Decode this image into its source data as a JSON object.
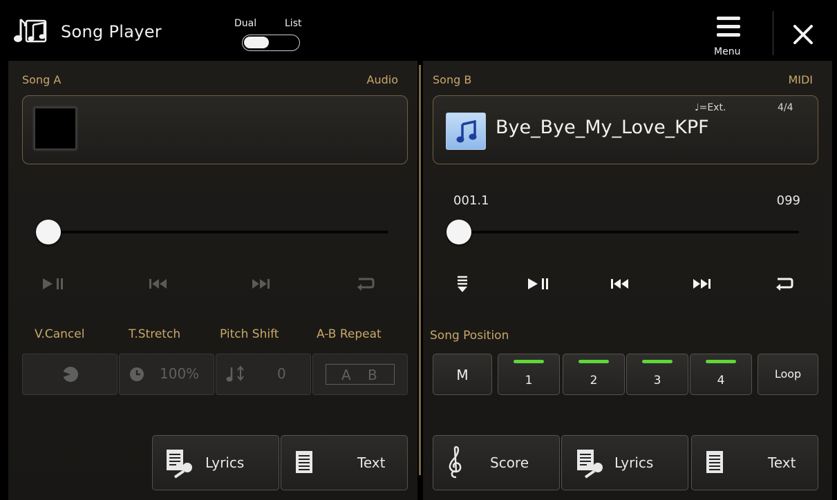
{
  "header": {
    "title": "Song Player",
    "mode_left_label": "Dual",
    "mode_right_label": "List",
    "menu_label": "Menu",
    "icons": {
      "app": "music-notes-icon",
      "menu": "hamburger-icon",
      "close": "close-icon"
    }
  },
  "song_a": {
    "label": "Song A",
    "type": "Audio",
    "song_name": "",
    "position": 0,
    "features": {
      "vcancel_label": "V.Cancel",
      "tstretch_label": "T.Stretch",
      "pitch_label": "Pitch Shift",
      "ab_label": "A-B Repeat",
      "tstretch_value": "100%",
      "pitch_value": "0",
      "ab_a": "A",
      "ab_b": "B"
    },
    "buttons": {
      "lyrics": "Lyrics",
      "text": "Text"
    }
  },
  "song_b": {
    "label": "Song B",
    "type": "MIDI",
    "song_name": "Bye_Bye_My_Love_KPF",
    "tempo": "♩=Ext.",
    "time_signature": "4/4",
    "bar_position": "001.1",
    "bar_end": "099",
    "position": 0,
    "song_position_label": "Song Position",
    "positions": {
      "m": "M",
      "p1": "1",
      "p2": "2",
      "p3": "3",
      "p4": "4",
      "loop": "Loop"
    },
    "buttons": {
      "score": "Score",
      "lyrics": "Lyrics",
      "text": "Text"
    }
  },
  "colors": {
    "accent_gold": "#c9a86a",
    "position_marker_green": "#5fd63a",
    "divider": "#7d6a48"
  }
}
